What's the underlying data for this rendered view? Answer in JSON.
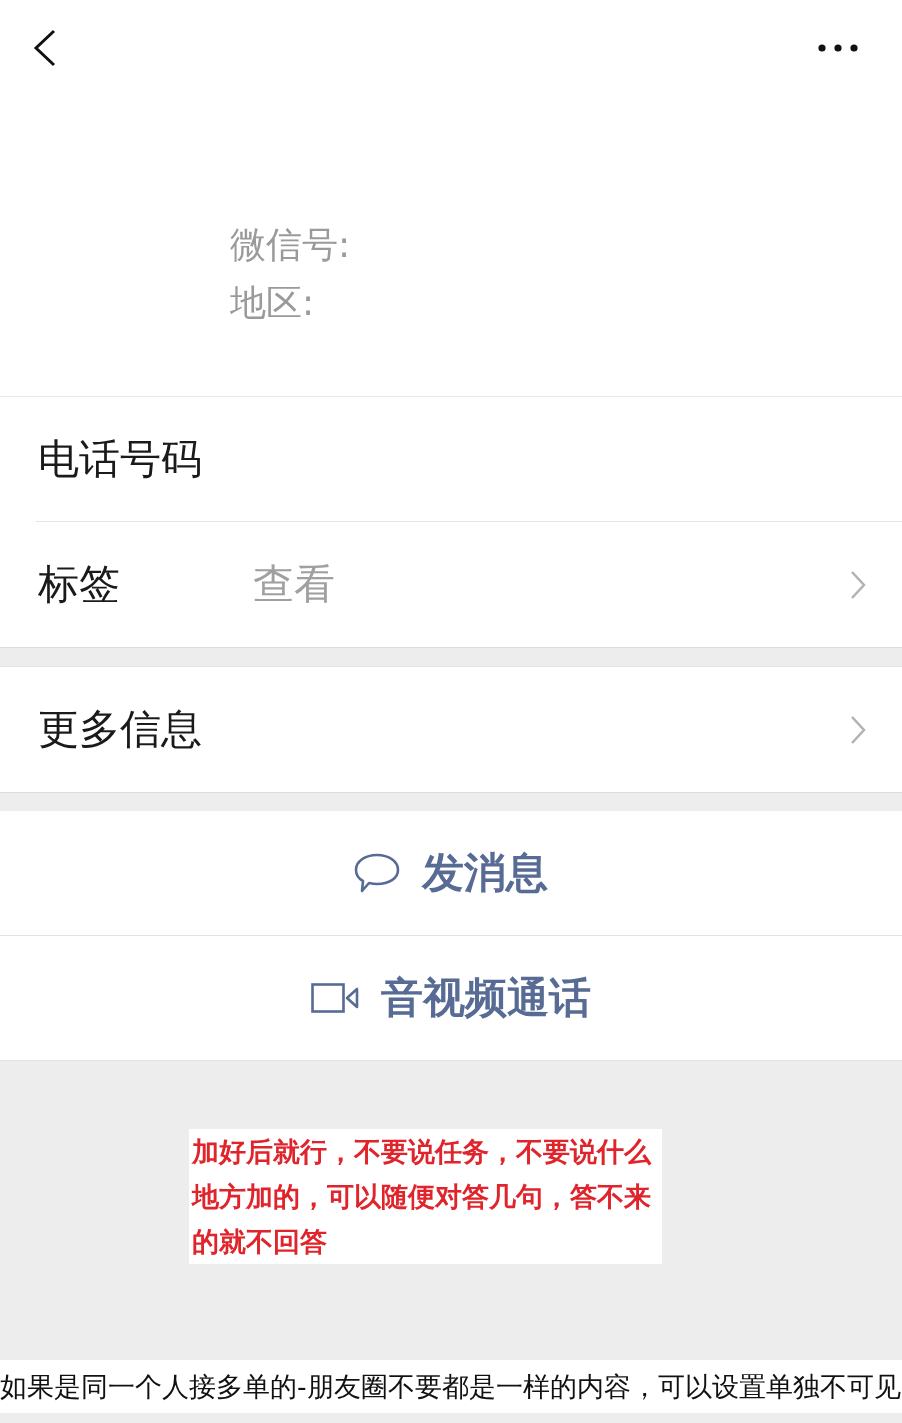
{
  "profile": {
    "fields": [
      "微信号:",
      "地区:"
    ]
  },
  "info_sections": [
    {
      "rows": [
        {
          "label": "电话号码",
          "has_arrow": false
        },
        {
          "label": "标签",
          "value": "查看",
          "has_arrow": true
        }
      ]
    },
    {
      "rows": [
        {
          "label": "更多信息",
          "has_arrow": true
        }
      ]
    }
  ],
  "actions": [
    {
      "kind": "message",
      "label": "发消息"
    },
    {
      "kind": "video",
      "label": "音视频通话"
    }
  ],
  "note": {
    "text": "加好后就行，不要说任务，不要说什么地方加的，可以随便对答几句，答不来的就不回答"
  },
  "caption": "如果是同一个人接多单的-朋友圈不要都是一样的内容，可以设置单独不可见"
}
